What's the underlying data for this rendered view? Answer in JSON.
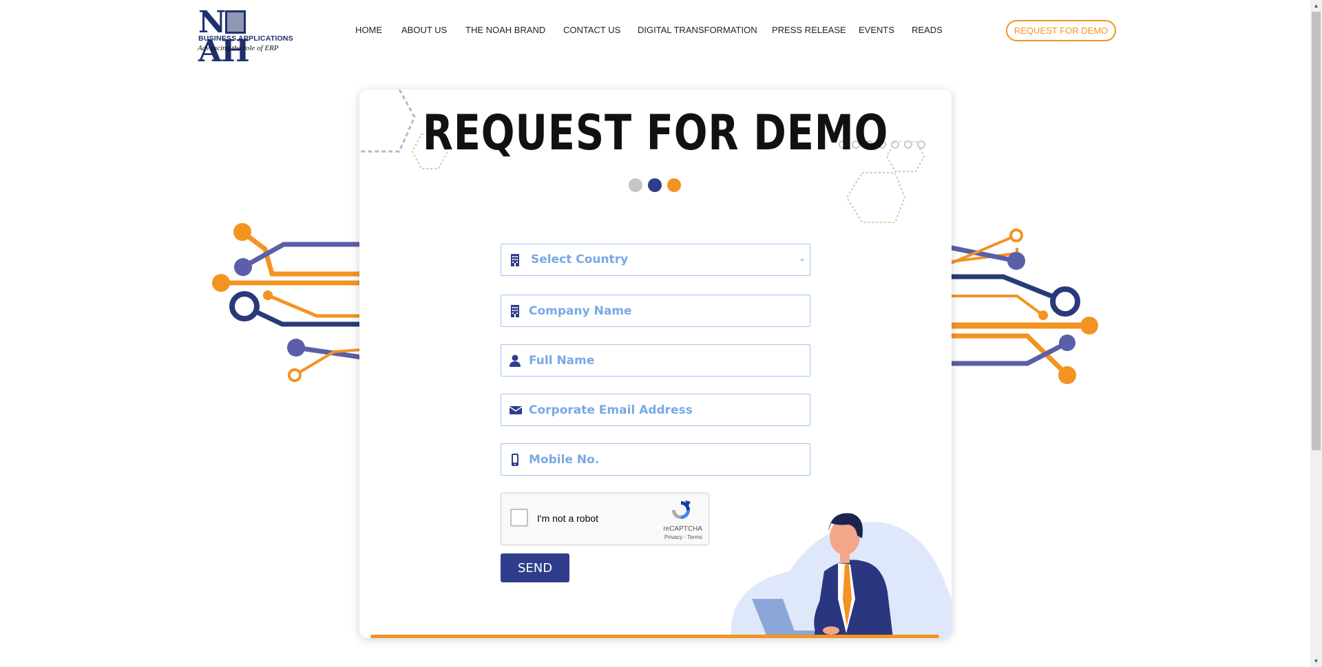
{
  "header": {
    "logo": {
      "main": "NOAH",
      "subtitle": "BUSINESS APPLICATIONS",
      "tagline": "Advancing the role of  ERP"
    },
    "nav": [
      {
        "label": "HOME"
      },
      {
        "label": "ABOUT US"
      },
      {
        "label": "THE NOAH BRAND"
      },
      {
        "label": "CONTACT US"
      },
      {
        "label": "DIGITAL TRANSFORMATION"
      },
      {
        "label": "PRESS RELEASE"
      },
      {
        "label": "EVENTS"
      },
      {
        "label": "READS"
      }
    ],
    "cta_label": "REQUEST FOR DEMO"
  },
  "card": {
    "title": "REQUEST FOR DEMO",
    "dot_colors": [
      "#c6c6c6",
      "#2f3d8c",
      "#f39322"
    ]
  },
  "form": {
    "country": {
      "selected": "Select Country",
      "icon": "building-icon"
    },
    "company": {
      "placeholder": "Company Name",
      "icon": "building-icon"
    },
    "full_name": {
      "placeholder": "Full Name",
      "icon": "user-icon"
    },
    "email": {
      "placeholder": "Corporate Email Address",
      "icon": "envelope-icon"
    },
    "mobile": {
      "placeholder": "Mobile No.",
      "icon": "mobile-icon"
    },
    "captcha": {
      "label": "I'm not a robot",
      "brand": "reCAPTCHA",
      "links": "Privacy - Terms"
    },
    "send_label": "SEND"
  },
  "colors": {
    "brand_navy": "#2f3d8c",
    "accent_orange": "#f39322",
    "field_text": "#78a8e6"
  }
}
